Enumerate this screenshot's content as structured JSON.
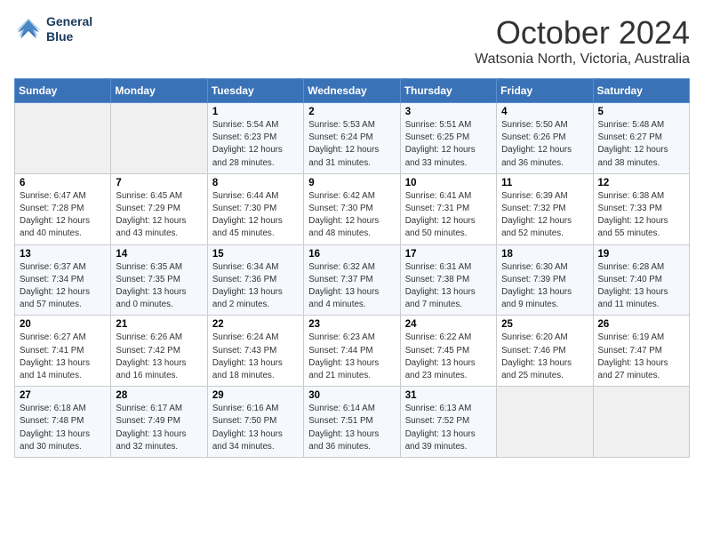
{
  "header": {
    "logo_line1": "General",
    "logo_line2": "Blue",
    "month": "October 2024",
    "location": "Watsonia North, Victoria, Australia"
  },
  "weekdays": [
    "Sunday",
    "Monday",
    "Tuesday",
    "Wednesday",
    "Thursday",
    "Friday",
    "Saturday"
  ],
  "weeks": [
    [
      {
        "day": "",
        "info": ""
      },
      {
        "day": "",
        "info": ""
      },
      {
        "day": "1",
        "info": "Sunrise: 5:54 AM\nSunset: 6:23 PM\nDaylight: 12 hours\nand 28 minutes."
      },
      {
        "day": "2",
        "info": "Sunrise: 5:53 AM\nSunset: 6:24 PM\nDaylight: 12 hours\nand 31 minutes."
      },
      {
        "day": "3",
        "info": "Sunrise: 5:51 AM\nSunset: 6:25 PM\nDaylight: 12 hours\nand 33 minutes."
      },
      {
        "day": "4",
        "info": "Sunrise: 5:50 AM\nSunset: 6:26 PM\nDaylight: 12 hours\nand 36 minutes."
      },
      {
        "day": "5",
        "info": "Sunrise: 5:48 AM\nSunset: 6:27 PM\nDaylight: 12 hours\nand 38 minutes."
      }
    ],
    [
      {
        "day": "6",
        "info": "Sunrise: 6:47 AM\nSunset: 7:28 PM\nDaylight: 12 hours\nand 40 minutes."
      },
      {
        "day": "7",
        "info": "Sunrise: 6:45 AM\nSunset: 7:29 PM\nDaylight: 12 hours\nand 43 minutes."
      },
      {
        "day": "8",
        "info": "Sunrise: 6:44 AM\nSunset: 7:30 PM\nDaylight: 12 hours\nand 45 minutes."
      },
      {
        "day": "9",
        "info": "Sunrise: 6:42 AM\nSunset: 7:30 PM\nDaylight: 12 hours\nand 48 minutes."
      },
      {
        "day": "10",
        "info": "Sunrise: 6:41 AM\nSunset: 7:31 PM\nDaylight: 12 hours\nand 50 minutes."
      },
      {
        "day": "11",
        "info": "Sunrise: 6:39 AM\nSunset: 7:32 PM\nDaylight: 12 hours\nand 52 minutes."
      },
      {
        "day": "12",
        "info": "Sunrise: 6:38 AM\nSunset: 7:33 PM\nDaylight: 12 hours\nand 55 minutes."
      }
    ],
    [
      {
        "day": "13",
        "info": "Sunrise: 6:37 AM\nSunset: 7:34 PM\nDaylight: 12 hours\nand 57 minutes."
      },
      {
        "day": "14",
        "info": "Sunrise: 6:35 AM\nSunset: 7:35 PM\nDaylight: 13 hours\nand 0 minutes."
      },
      {
        "day": "15",
        "info": "Sunrise: 6:34 AM\nSunset: 7:36 PM\nDaylight: 13 hours\nand 2 minutes."
      },
      {
        "day": "16",
        "info": "Sunrise: 6:32 AM\nSunset: 7:37 PM\nDaylight: 13 hours\nand 4 minutes."
      },
      {
        "day": "17",
        "info": "Sunrise: 6:31 AM\nSunset: 7:38 PM\nDaylight: 13 hours\nand 7 minutes."
      },
      {
        "day": "18",
        "info": "Sunrise: 6:30 AM\nSunset: 7:39 PM\nDaylight: 13 hours\nand 9 minutes."
      },
      {
        "day": "19",
        "info": "Sunrise: 6:28 AM\nSunset: 7:40 PM\nDaylight: 13 hours\nand 11 minutes."
      }
    ],
    [
      {
        "day": "20",
        "info": "Sunrise: 6:27 AM\nSunset: 7:41 PM\nDaylight: 13 hours\nand 14 minutes."
      },
      {
        "day": "21",
        "info": "Sunrise: 6:26 AM\nSunset: 7:42 PM\nDaylight: 13 hours\nand 16 minutes."
      },
      {
        "day": "22",
        "info": "Sunrise: 6:24 AM\nSunset: 7:43 PM\nDaylight: 13 hours\nand 18 minutes."
      },
      {
        "day": "23",
        "info": "Sunrise: 6:23 AM\nSunset: 7:44 PM\nDaylight: 13 hours\nand 21 minutes."
      },
      {
        "day": "24",
        "info": "Sunrise: 6:22 AM\nSunset: 7:45 PM\nDaylight: 13 hours\nand 23 minutes."
      },
      {
        "day": "25",
        "info": "Sunrise: 6:20 AM\nSunset: 7:46 PM\nDaylight: 13 hours\nand 25 minutes."
      },
      {
        "day": "26",
        "info": "Sunrise: 6:19 AM\nSunset: 7:47 PM\nDaylight: 13 hours\nand 27 minutes."
      }
    ],
    [
      {
        "day": "27",
        "info": "Sunrise: 6:18 AM\nSunset: 7:48 PM\nDaylight: 13 hours\nand 30 minutes."
      },
      {
        "day": "28",
        "info": "Sunrise: 6:17 AM\nSunset: 7:49 PM\nDaylight: 13 hours\nand 32 minutes."
      },
      {
        "day": "29",
        "info": "Sunrise: 6:16 AM\nSunset: 7:50 PM\nDaylight: 13 hours\nand 34 minutes."
      },
      {
        "day": "30",
        "info": "Sunrise: 6:14 AM\nSunset: 7:51 PM\nDaylight: 13 hours\nand 36 minutes."
      },
      {
        "day": "31",
        "info": "Sunrise: 6:13 AM\nSunset: 7:52 PM\nDaylight: 13 hours\nand 39 minutes."
      },
      {
        "day": "",
        "info": ""
      },
      {
        "day": "",
        "info": ""
      }
    ]
  ]
}
